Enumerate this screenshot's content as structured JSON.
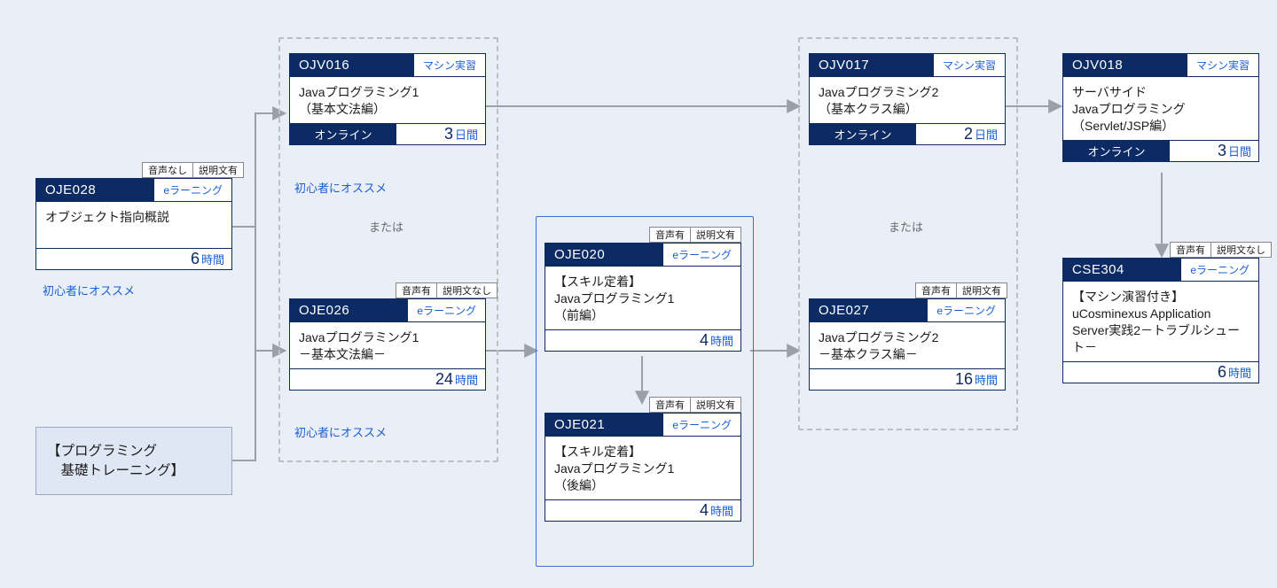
{
  "labels": {
    "machine_practice": "マシン実習",
    "e_learning": "eラーニング",
    "online": "オンライン",
    "days": "日間",
    "hours": "時間",
    "recommend": "初心者にオススメ",
    "or": "または"
  },
  "flags": {
    "audio_yes": "音声有",
    "audio_no": "音声なし",
    "desc_yes": "説明文有",
    "desc_no": "説明文なし"
  },
  "intro_box": {
    "line1": "【プログラミング",
    "line2": "　基礎トレーニング】"
  },
  "cards": {
    "OJE028": {
      "code": "OJE028",
      "title": "オブジェクト指向概説",
      "tag": "e_learning",
      "duration_num": "6",
      "duration_unit": "hours",
      "recommend": true,
      "flags": [
        "audio_no",
        "desc_yes"
      ]
    },
    "OJV016": {
      "code": "OJV016",
      "title": "Javaプログラミング1\n（基本文法編）",
      "tag": "machine_practice",
      "mode": "online",
      "duration_num": "3",
      "duration_unit": "days",
      "recommend": true
    },
    "OJE026": {
      "code": "OJE026",
      "title": "Javaプログラミング1\n－基本文法編－",
      "tag": "e_learning",
      "duration_num": "24",
      "duration_unit": "hours",
      "recommend": true,
      "flags": [
        "audio_yes",
        "desc_no"
      ]
    },
    "OJE020": {
      "code": "OJE020",
      "title": "【スキル定着】\nJavaプログラミング1\n（前編）",
      "tag": "e_learning",
      "duration_num": "4",
      "duration_unit": "hours",
      "flags": [
        "audio_yes",
        "desc_yes"
      ]
    },
    "OJE021": {
      "code": "OJE021",
      "title": "【スキル定着】\nJavaプログラミング1\n（後編）",
      "tag": "e_learning",
      "duration_num": "4",
      "duration_unit": "hours",
      "flags": [
        "audio_yes",
        "desc_yes"
      ]
    },
    "OJV017": {
      "code": "OJV017",
      "title": "Javaプログラミング2\n（基本クラス編）",
      "tag": "machine_practice",
      "mode": "online",
      "duration_num": "2",
      "duration_unit": "days"
    },
    "OJE027": {
      "code": "OJE027",
      "title": "Javaプログラミング2\n－基本クラス編－",
      "tag": "e_learning",
      "duration_num": "16",
      "duration_unit": "hours",
      "flags": [
        "audio_yes",
        "desc_yes"
      ]
    },
    "OJV018": {
      "code": "OJV018",
      "title": "サーバサイド\nJavaプログラミング\n（Servlet/JSP編）",
      "tag": "machine_practice",
      "mode": "online",
      "duration_num": "3",
      "duration_unit": "days"
    },
    "CSE304": {
      "code": "CSE304",
      "title": "【マシン演習付き】\nuCosminexus Application\nServer実践2－トラブルシュート－",
      "tag": "e_learning",
      "duration_num": "6",
      "duration_unit": "hours",
      "flags": [
        "audio_yes",
        "desc_no"
      ]
    }
  }
}
